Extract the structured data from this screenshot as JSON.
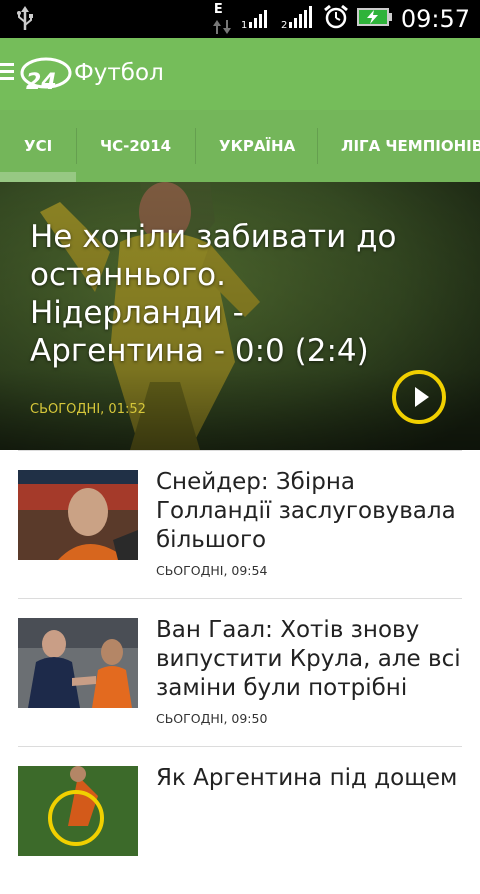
{
  "status_bar": {
    "time": "09:57",
    "network": "E",
    "icons": [
      "usb-icon",
      "data-transfer-icon",
      "signal-1-icon",
      "signal-2-icon",
      "alarm-clock-icon",
      "battery-charging-icon"
    ]
  },
  "app_bar": {
    "logo_text": "24",
    "title": "Футбол"
  },
  "tabs": [
    {
      "label": "УСІ",
      "selected": true
    },
    {
      "label": "ЧС-2014",
      "selected": false
    },
    {
      "label": "УКРАЇНА",
      "selected": false
    },
    {
      "label": "ЛІГА ЧЕМПІОНІВ",
      "selected": false
    }
  ],
  "featured": {
    "headline": "Не хотіли забивати до останнього. Нідерланди - Аргентина - 0:0 (2:4)",
    "timestamp": "СЬОГОДНІ, 01:52",
    "accent_color": "#f1d000"
  },
  "news": [
    {
      "headline": "Снейдер: Збірна Голландії заслуговувала більшого",
      "timestamp": "СЬОГОДНІ, 09:54"
    },
    {
      "headline": "Ван Гаал: Хотів знову випустити Крула, але всі заміни були потрібні",
      "timestamp": "СЬОГОДНІ, 09:50"
    },
    {
      "headline": "Як Аргентина під дощем",
      "timestamp": ""
    }
  ],
  "colors": {
    "app_bar": "#75bd5a",
    "tabs": "#74b65a",
    "status_bar": "#000000"
  }
}
